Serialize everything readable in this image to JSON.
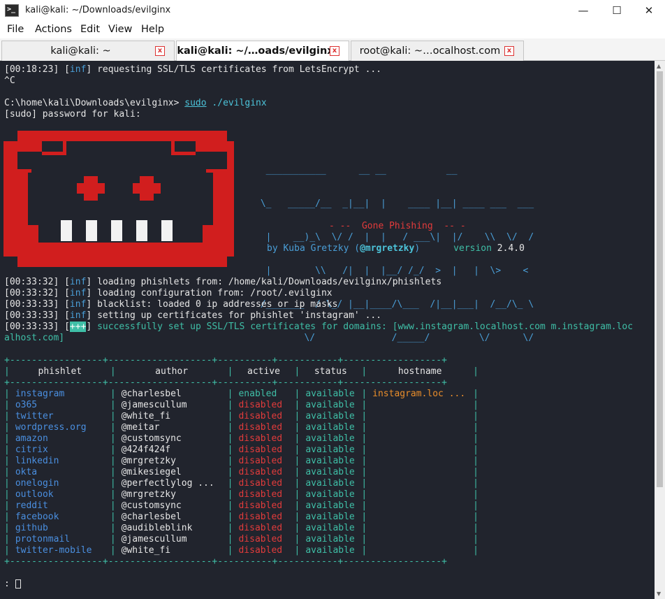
{
  "window": {
    "title": "kali@kali: ~/Downloads/evilginx",
    "icon": "terminal-icon",
    "controls": {
      "minimize": "—",
      "maximize": "☐",
      "close": "✕"
    }
  },
  "menu": [
    "File",
    "Actions",
    "Edit",
    "View",
    "Help"
  ],
  "tabs": [
    {
      "label": "kali@kali: ~",
      "close": "x",
      "active": false
    },
    {
      "label": "kali@kali: ~/…oads/evilginx",
      "close": "x",
      "active": true
    },
    {
      "label": "root@kali: ~…ocalhost.com",
      "close": "x",
      "active": false
    }
  ],
  "terminal": {
    "pre_lines": [
      {
        "ts": "[00:18:23] [",
        "tag": "inf",
        "end": "] ",
        "msg": "requesting SSL/TLS certificates from LetsEncrypt ..."
      },
      {
        "text": "^C"
      },
      {
        "text": ""
      }
    ],
    "prompt": {
      "path": "C:\\home\\kali\\Downloads\\evilginx> ",
      "sudo": "sudo",
      "cmd": " ./evilginx"
    },
    "sudo_line": "[sudo] password for kali:",
    "banner": {
      "ascii": [
        "  ___________      __ __           __",
        " \\_   _____/__  _|__|  |    ____ |__| ____ ___  ___",
        "  |    __)_\\  \\/ /  |  |   / ___\\|  |/    \\\\  \\/  /",
        "  |        \\\\   /|  |  |__/ /_/  >  |   |  \\>    <",
        " /_______  / \\_/ |__|____/\\___  /|__|___|  /__/\\_ \\",
        "         \\/              /_____/         \\/      \\/"
      ],
      "tagline": "- --  Gone Phishing  -- -",
      "by": "by Kuba Gretzky (",
      "handle": "@mrgretzky",
      "by_end": ")",
      "version_label": "version ",
      "version": "2.4.0"
    },
    "log_lines": [
      {
        "ts": "[00:33:32] [",
        "tag": "inf",
        "end": "] ",
        "msg": "loading phishlets from: /home/kali/Downloads/evilginx/phishlets"
      },
      {
        "ts": "[00:33:32] [",
        "tag": "inf",
        "end": "] ",
        "msg": "loading configuration from: /root/.evilginx"
      },
      {
        "ts": "[00:33:33] [",
        "tag": "inf",
        "end": "] ",
        "msg": "blacklist: loaded 0 ip addresses or ip masks"
      },
      {
        "ts": "[00:33:33] [",
        "tag": "inf",
        "end": "] ",
        "msg": "setting up certificates for phishlet 'instagram' ..."
      }
    ],
    "success_line": {
      "ts": "[00:33:33] [",
      "tag": "+++",
      "end": "] ",
      "msg": "successfully set up SSL/TLS certificates for domains: [www.instagram.localhost.com m.instagram.loc",
      "msg2": "alhost.com]"
    },
    "table": {
      "border_top": "+-----------------+-------------------+----------+-----------+------------------+",
      "headers": [
        "phishlet",
        "author",
        "active",
        "status",
        "hostname"
      ],
      "rows": [
        [
          "instagram",
          "@charlesbel",
          "enabled",
          "available",
          "instagram.loc ..."
        ],
        [
          "o365",
          "@jamescullum",
          "disabled",
          "available",
          ""
        ],
        [
          "twitter",
          "@white_fi",
          "disabled",
          "available",
          ""
        ],
        [
          "wordpress.org",
          "@meitar",
          "disabled",
          "available",
          ""
        ],
        [
          "amazon",
          "@customsync",
          "disabled",
          "available",
          ""
        ],
        [
          "citrix",
          "@424f424f",
          "disabled",
          "available",
          ""
        ],
        [
          "linkedin",
          "@mrgretzky",
          "disabled",
          "available",
          ""
        ],
        [
          "okta",
          "@mikesiegel",
          "disabled",
          "available",
          ""
        ],
        [
          "onelogin",
          "@perfectlylog ...",
          "disabled",
          "available",
          ""
        ],
        [
          "outlook",
          "@mrgretzky",
          "disabled",
          "available",
          ""
        ],
        [
          "reddit",
          "@customsync",
          "disabled",
          "available",
          ""
        ],
        [
          "facebook",
          "@charlesbel",
          "disabled",
          "available",
          ""
        ],
        [
          "github",
          "@audibleblink",
          "disabled",
          "available",
          ""
        ],
        [
          "protonmail",
          "@jamescullum",
          "disabled",
          "available",
          ""
        ],
        [
          "twitter-mobile",
          "@white_fi",
          "disabled",
          "available",
          ""
        ]
      ]
    },
    "input_prompt": ": "
  }
}
